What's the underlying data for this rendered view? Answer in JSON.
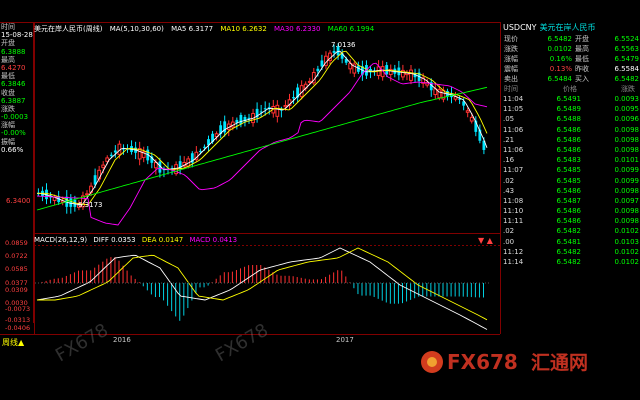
{
  "chart_header": {
    "title": "美元在岸人民币(周线)",
    "ma_label": "MA(5,10,30,60)",
    "ma5": "MA5 6.3177",
    "ma10": "MA10 6.2632",
    "ma30": "MA30 6.2330",
    "ma60": "MA60 6.1994",
    "colors": {
      "ma5": "#ffffff",
      "ma10": "#ffff00",
      "ma30": "#ff00ff",
      "ma60": "#00ff00"
    }
  },
  "info_panel": [
    {
      "label": "时间",
      "value": "15-08-28",
      "vclass": "wh"
    },
    {
      "label": "开盘",
      "value": "6.3888",
      "vclass": "dn"
    },
    {
      "label": "最高",
      "value": "6.4270",
      "vclass": "up"
    },
    {
      "label": "最低",
      "value": "6.3846",
      "vclass": "dn"
    },
    {
      "label": "收盘",
      "value": "6.3887",
      "vclass": "dn"
    },
    {
      "label": "涨跌",
      "value": "-0.0003",
      "vclass": "dn"
    },
    {
      "label": "涨幅",
      "value": "-0.00%",
      "vclass": "dn"
    },
    {
      "label": "振幅",
      "value": "0.66%",
      "vclass": "wh"
    }
  ],
  "price_axis": {
    "label_top": "7.0136",
    "label_low": "6.3173",
    "label_mid": "6.3400"
  },
  "macd_header": {
    "label": "MACD(26,12,9)",
    "diff": "DIFF 0.0353",
    "dea": "DEA 0.0147",
    "macd": "MACD 0.0413"
  },
  "macd_axis": [
    "0.0859",
    "0.0722",
    "0.0585",
    "0.0377",
    "0.0309",
    "0.0030",
    "-0.0073",
    "-0.0313",
    "-0.0406"
  ],
  "time_axis": {
    "period": "周线▲",
    "year1": "2016",
    "year2": "2017"
  },
  "quote": {
    "symbol": "USDCNY",
    "name": "美元在岸人民币",
    "rows": [
      {
        "l1": "现价",
        "v1": "6.5482",
        "l2": "开盘",
        "v2": "6.5524"
      },
      {
        "l1": "涨跌",
        "v1": "0.0102",
        "l2": "最高",
        "v2": "6.5563"
      },
      {
        "l1": "涨幅",
        "v1": "0.16%",
        "l2": "最低",
        "v2": "6.5479"
      },
      {
        "l1": "震幅",
        "v1": "0.13%",
        "l2": "昨收",
        "v2": "6.5584"
      },
      {
        "l1": "卖出",
        "v1": "6.5484",
        "l2": "买入",
        "v2": "6.5482"
      }
    ],
    "ticks_header": {
      "time": "时间",
      "price": "价格",
      "chg": "涨跌"
    },
    "ticks": [
      {
        "t": "11:04",
        "p": "6.5491",
        "c": "0.0093"
      },
      {
        "t": "11:05",
        "p": "6.5489",
        "c": "0.0095"
      },
      {
        "t": ".05",
        "p": "6.5488",
        "c": "0.0096"
      },
      {
        "t": "11:06",
        "p": "6.5486",
        "c": "0.0098"
      },
      {
        "t": ".21",
        "p": "6.5486",
        "c": "0.0098"
      },
      {
        "t": "11:06",
        "p": "6.5486",
        "c": "0.0098"
      },
      {
        "t": ".16",
        "p": "6.5483",
        "c": "0.0101"
      },
      {
        "t": "11:07",
        "p": "6.5485",
        "c": "0.0099"
      },
      {
        "t": ".02",
        "p": "6.5485",
        "c": "0.0099"
      },
      {
        "t": ".43",
        "p": "6.5486",
        "c": "0.0098"
      },
      {
        "t": "11:08",
        "p": "6.5487",
        "c": "0.0097"
      },
      {
        "t": "11:10",
        "p": "6.5486",
        "c": "0.0098"
      },
      {
        "t": "11:11",
        "p": "6.5486",
        "c": "0.0098"
      },
      {
        "t": ".02",
        "p": "6.5482",
        "c": "0.0102"
      },
      {
        "t": ".00",
        "p": "6.5481",
        "c": "0.0103"
      },
      {
        "t": "11:12",
        "p": "6.5482",
        "c": "0.0102"
      },
      {
        "t": "11:14",
        "p": "6.5482",
        "c": "0.0102"
      }
    ]
  },
  "watermark": {
    "text": "FX678",
    "brand": "汇通网"
  }
}
